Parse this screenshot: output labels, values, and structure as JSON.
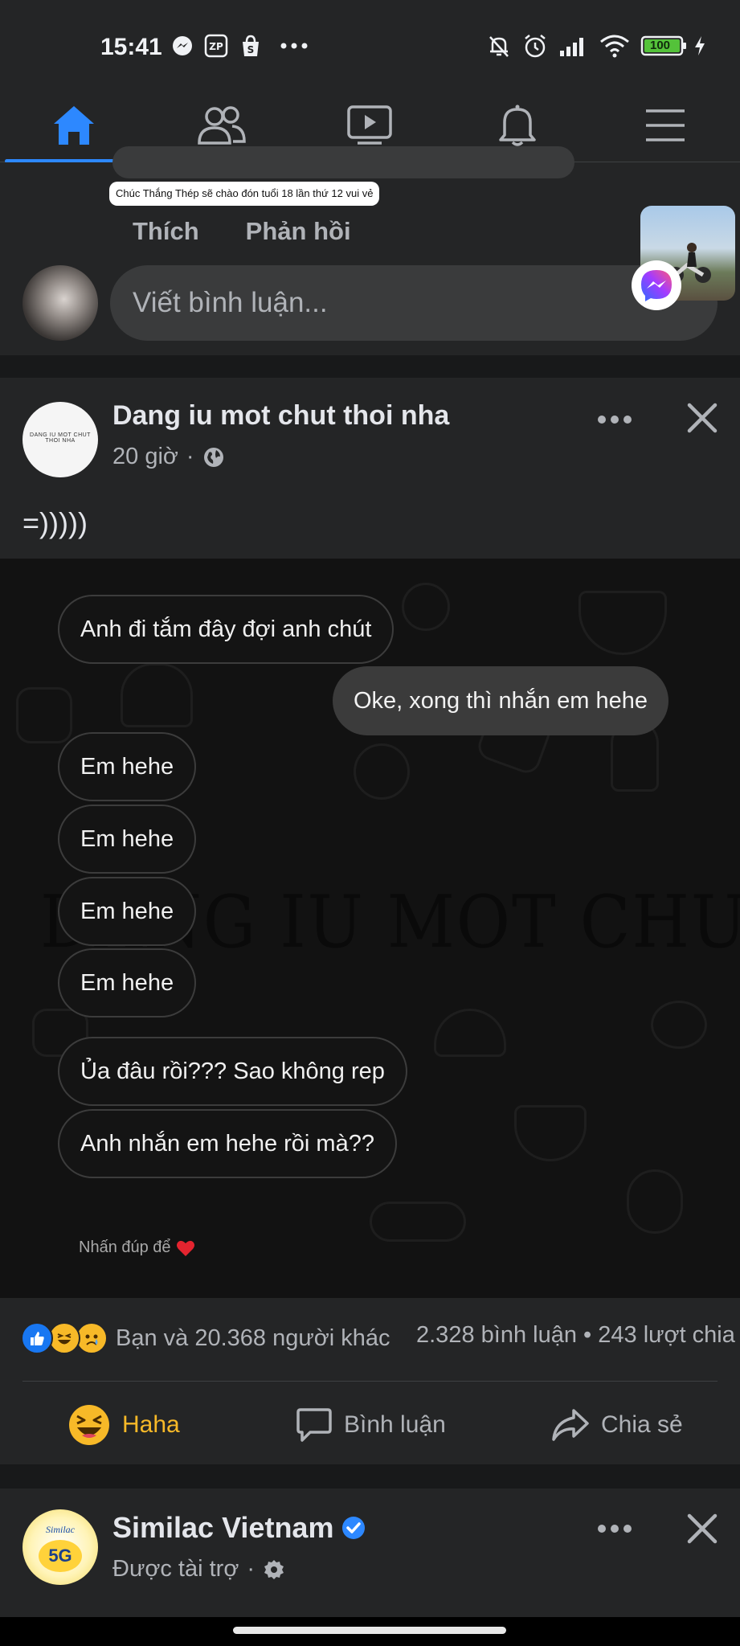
{
  "status_bar": {
    "time": "15:41",
    "left_icons": [
      "messenger-icon",
      "zalopay-icon",
      "shopee-icon",
      "more-dots-icon"
    ],
    "right_icons": [
      "mute-icon",
      "alarm-icon",
      "signal-icon",
      "wifi-icon",
      "battery-icon",
      "charging-icon"
    ],
    "battery": "100"
  },
  "nav": {
    "tabs": [
      "home",
      "friends",
      "watch",
      "notifications",
      "menu"
    ],
    "active": "home",
    "accent": "#2d88ff"
  },
  "previous_post": {
    "sticker_caption": "Chúc Thắng Thép sẽ chào đón tuổi 18 lần thứ 12 vui vẻ",
    "like_label": "Thích",
    "reply_label": "Phản hồi",
    "comment_placeholder": "Viết bình luận..."
  },
  "post": {
    "page_name": "Dang iu mot chut thoi nha",
    "avatar_text": "DANG IU MOT CHUT THOI NHA",
    "time": "20 giờ",
    "audience_icon": "globe-icon",
    "text": "=)))))",
    "image": {
      "watermark": "DANG IU MOT CHUT THOI NHA",
      "messages": [
        {
          "side": "in",
          "text": "Anh đi tắm đây đợi anh chút"
        },
        {
          "side": "out",
          "text": "Oke, xong thì nhắn em hehe"
        },
        {
          "side": "in",
          "text": "Em hehe"
        },
        {
          "side": "in",
          "text": "Em hehe"
        },
        {
          "side": "in",
          "text": "Em hehe"
        },
        {
          "side": "in",
          "text": "Em hehe"
        },
        {
          "side": "in",
          "text": "Ủa đâu rồi??? Sao không rep"
        },
        {
          "side": "in",
          "text": "Anh nhắn em hehe rồi mà??"
        }
      ],
      "hint": "Nhấn đúp để"
    },
    "reactions_summary": "Bạn và 20.368 người khác",
    "comments_count": "2.328 bình luận",
    "shares_count": "243 lượt chia",
    "separator": "•",
    "actions": {
      "haha": "Haha",
      "comment": "Bình luận",
      "share": "Chia sẻ"
    },
    "haha_color": "#f7b928"
  },
  "sponsored": {
    "name": "Similac Vietnam",
    "avatar_brand": "Similac",
    "avatar_badge": "5G",
    "meta": "Được tài trợ",
    "verified_color": "#2d88ff"
  }
}
